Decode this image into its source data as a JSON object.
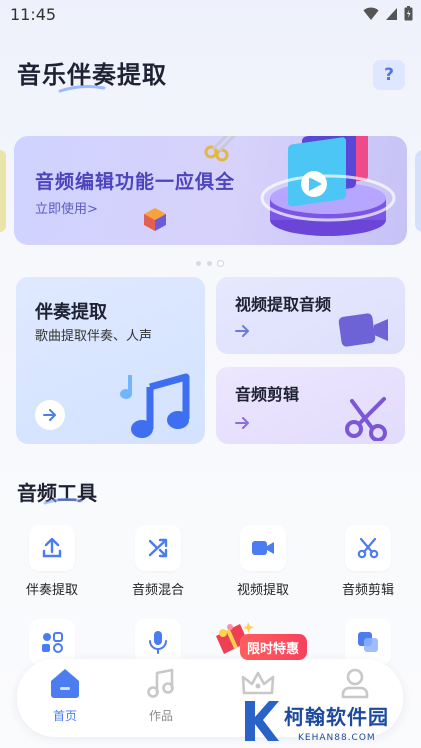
{
  "status_bar": {
    "time": "11:45"
  },
  "header": {
    "title": "音乐伴奏提取",
    "help_label": "?"
  },
  "banner": {
    "title": "音频编辑功能一应俱全",
    "subtitle": "立即使用",
    "subtitle_chevron": ">",
    "dots_count": 3,
    "active_dot": 2
  },
  "cards": {
    "accompaniment": {
      "title": "伴奏提取",
      "subtitle": "歌曲提取伴奏、人声"
    },
    "video_audio": {
      "title": "视频提取音频"
    },
    "audio_cut": {
      "title": "音频剪辑"
    }
  },
  "tools_section": {
    "title": "音频工具"
  },
  "tools": [
    {
      "label": "伴奏提取",
      "icon": "upload-icon"
    },
    {
      "label": "音频混合",
      "icon": "shuffle-icon"
    },
    {
      "label": "视频提取",
      "icon": "video-camera-icon"
    },
    {
      "label": "音频剪辑",
      "icon": "scissors-icon"
    }
  ],
  "tools_row2_icons": [
    "convert-icon",
    "microphone-icon",
    "gift-icon",
    "layers-icon"
  ],
  "promo": {
    "label": "限时特惠"
  },
  "tabbar": {
    "tabs": [
      {
        "label": "首页",
        "icon": "home-icon",
        "active": true
      },
      {
        "label": "作品",
        "icon": "music-note-icon",
        "active": false
      },
      {
        "label": "",
        "icon": "crown-icon",
        "active": false
      },
      {
        "label": "",
        "icon": "profile-icon",
        "active": false
      }
    ]
  },
  "watermark": {
    "text": "柯翰软件园",
    "url": "KEHAN88.COM"
  },
  "colors": {
    "accent": "#4b7cf0",
    "banner_text": "#4c45bc",
    "promo": "#f7405c",
    "watermark": "#1d4a9e"
  }
}
